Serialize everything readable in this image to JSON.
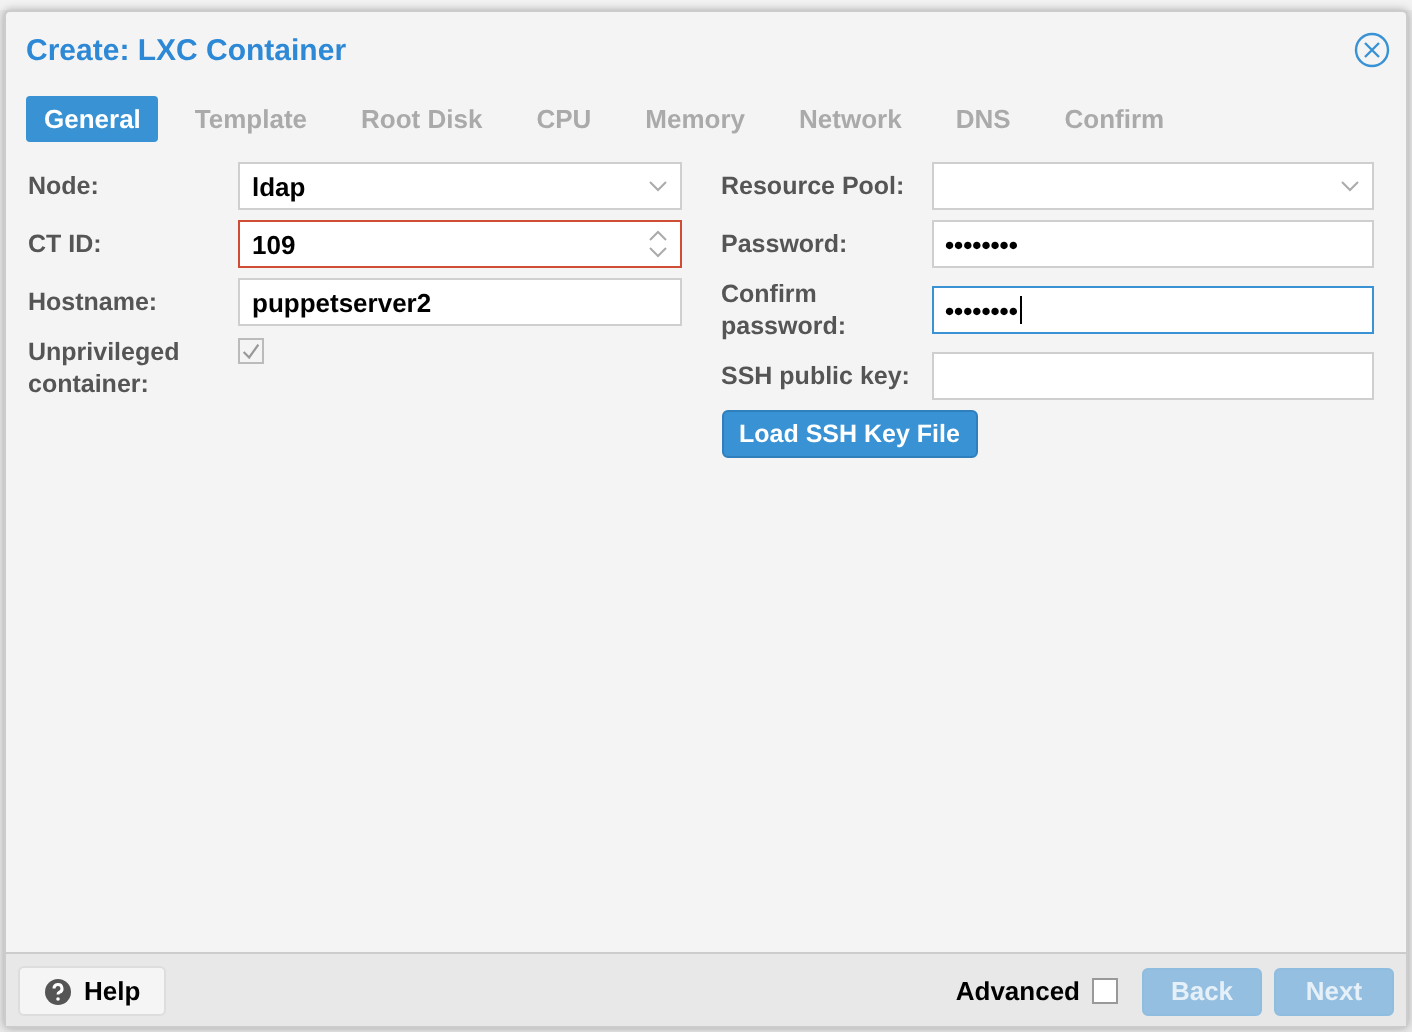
{
  "window": {
    "title": "Create: LXC Container"
  },
  "tabs": [
    {
      "label": "General",
      "selected": true
    },
    {
      "label": "Template",
      "selected": false
    },
    {
      "label": "Root Disk",
      "selected": false
    },
    {
      "label": "CPU",
      "selected": false
    },
    {
      "label": "Memory",
      "selected": false
    },
    {
      "label": "Network",
      "selected": false
    },
    {
      "label": "DNS",
      "selected": false
    },
    {
      "label": "Confirm",
      "selected": false
    }
  ],
  "left_fields": [
    {
      "label": "Node:",
      "kind": "combo",
      "value": "ldap",
      "invalid": false,
      "focused": false
    },
    {
      "label": "CT ID:",
      "kind": "number",
      "value": "109",
      "invalid": true,
      "focused": false
    },
    {
      "label": "Hostname:",
      "kind": "text",
      "value": "puppetserver2",
      "invalid": false,
      "focused": false
    },
    {
      "label": "Unprivileged container:",
      "kind": "checkbox",
      "checked": true
    }
  ],
  "right_fields": [
    {
      "label": "Resource Pool:",
      "kind": "combo",
      "invalid": false,
      "focused": false
    },
    {
      "label": "Password:",
      "kind": "text",
      "value": "••••••••",
      "invalid": false,
      "focused": false
    },
    {
      "label": "Confirm password:",
      "kind": "text",
      "value": "••••••••",
      "invalid": false,
      "focused": true
    },
    {
      "label": "SSH public key:",
      "kind": "text",
      "invalid": false,
      "focused": false
    }
  ],
  "load_button": "Load SSH Key File",
  "footer": {
    "help": "Help",
    "advanced": {
      "label": "Advanced",
      "checked": false
    },
    "buttons": [
      {
        "label": "Back",
        "disabled": true
      },
      {
        "label": "Next",
        "disabled": true
      }
    ]
  }
}
